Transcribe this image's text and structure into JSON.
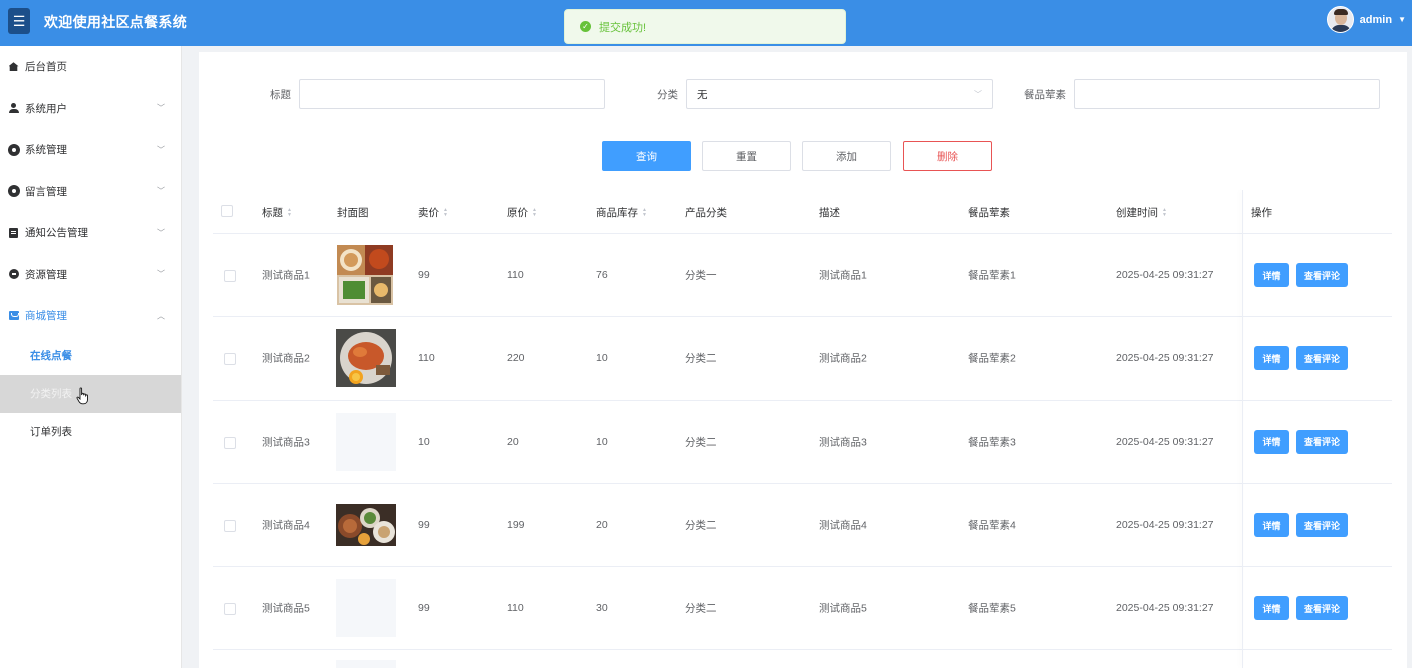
{
  "header": {
    "title": "欢迎使用社区点餐系统",
    "username": "admin",
    "menu_icon": "hamburger-icon"
  },
  "toast": {
    "message": "提交成功!",
    "icon": "success-check-icon",
    "color": "#67c23a"
  },
  "sidebar": {
    "items": [
      {
        "label": "后台首页",
        "icon": "home-icon",
        "expandable": false
      },
      {
        "label": "系统用户",
        "icon": "user-icon",
        "expandable": true
      },
      {
        "label": "系统管理",
        "icon": "gear-icon",
        "expandable": true
      },
      {
        "label": "留言管理",
        "icon": "gear-icon",
        "expandable": true
      },
      {
        "label": "通知公告管理",
        "icon": "document-icon",
        "expandable": true
      },
      {
        "label": "资源管理",
        "icon": "resource-icon",
        "expandable": true
      },
      {
        "label": "商城管理",
        "icon": "shop-icon",
        "expandable": true,
        "expanded": true
      }
    ],
    "subitems": [
      {
        "label": "在线点餐",
        "state": "current"
      },
      {
        "label": "分类列表",
        "state": "hover"
      },
      {
        "label": "订单列表",
        "state": "normal"
      }
    ]
  },
  "search": {
    "title_label": "标题",
    "title_value": "",
    "category_label": "分类",
    "category_value": "无",
    "meat_label": "餐品荤素",
    "meat_value": ""
  },
  "actions": {
    "query": "查询",
    "reset": "重置",
    "add": "添加",
    "delete": "删除"
  },
  "table": {
    "columns": [
      "标题",
      "封面图",
      "卖价",
      "原价",
      "商品库存",
      "产品分类",
      "描述",
      "餐品荤素",
      "创建时间",
      "操作"
    ],
    "rows": [
      {
        "title": "测试商品1",
        "price": "99",
        "original": "110",
        "stock": "76",
        "category": "分类一",
        "desc": "测试商品1",
        "meat": "餐品荤素1",
        "created": "2025-04-25 09:31:27",
        "image": "food-photo-1"
      },
      {
        "title": "测试商品2",
        "price": "110",
        "original": "220",
        "stock": "10",
        "category": "分类二",
        "desc": "测试商品2",
        "meat": "餐品荤素2",
        "created": "2025-04-25 09:31:27",
        "image": "food-photo-2"
      },
      {
        "title": "测试商品3",
        "price": "10",
        "original": "20",
        "stock": "10",
        "category": "分类二",
        "desc": "测试商品3",
        "meat": "餐品荤素3",
        "created": "2025-04-25 09:31:27",
        "image": "empty"
      },
      {
        "title": "测试商品4",
        "price": "99",
        "original": "199",
        "stock": "20",
        "category": "分类二",
        "desc": "测试商品4",
        "meat": "餐品荤素4",
        "created": "2025-04-25 09:31:27",
        "image": "food-photo-4"
      },
      {
        "title": "测试商品5",
        "price": "99",
        "original": "110",
        "stock": "30",
        "category": "分类二",
        "desc": "测试商品5",
        "meat": "餐品荤素5",
        "created": "2025-04-25 09:31:27",
        "image": "empty"
      }
    ],
    "detail_label": "详情",
    "comments_label": "查看评论"
  },
  "colors": {
    "header": "#3a8ee6",
    "primary": "#409eff",
    "danger": "#e85454",
    "success": "#67c23a"
  }
}
